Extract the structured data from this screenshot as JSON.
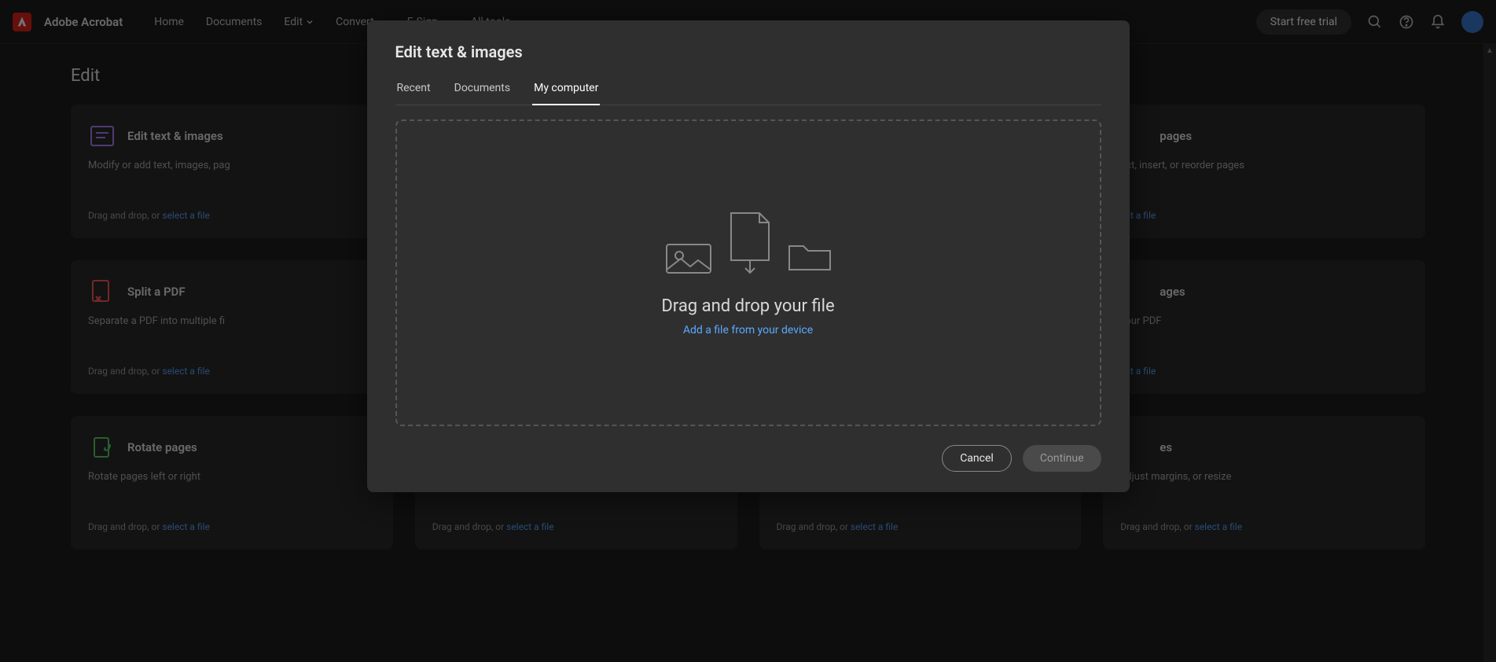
{
  "brand": "Adobe Acrobat",
  "nav": {
    "home": "Home",
    "documents": "Documents",
    "edit": "Edit",
    "convert": "Convert",
    "esign": "E-Sign",
    "alltools": "All tools"
  },
  "trial_btn": "Start free trial",
  "page_title": "Edit",
  "cards": [
    {
      "title": "Edit text & images",
      "desc": "Modify or add text, images, pag",
      "drag": "Drag and drop, or ",
      "link": "select a file"
    },
    {
      "title": "",
      "desc": "",
      "drag": "",
      "link": ""
    },
    {
      "title": "",
      "desc": "",
      "drag": "",
      "link": ""
    },
    {
      "title": "pages",
      "desc": "act, insert, or reorder pages",
      "drag": "",
      "link": "ect a file"
    },
    {
      "title": "Split a PDF",
      "desc": "Separate a PDF into multiple fi",
      "drag": "Drag and drop, or ",
      "link": "select a file"
    },
    {
      "title": "",
      "desc": "",
      "drag": "",
      "link": ""
    },
    {
      "title": "",
      "desc": "",
      "drag": "",
      "link": ""
    },
    {
      "title": "ages",
      "desc": "your PDF",
      "drag": "",
      "link": "ect a file"
    },
    {
      "title": "Rotate pages",
      "desc": "Rotate pages left or right",
      "drag": "Drag and drop, or ",
      "link": "select a file"
    },
    {
      "title": "",
      "desc": "",
      "drag": "Drag and drop, or ",
      "link": "select a file"
    },
    {
      "title": "",
      "desc": "",
      "drag": "Drag and drop, or ",
      "link": "select a file"
    },
    {
      "title": "es",
      "desc": "adjust margins, or resize",
      "drag": "Drag and drop, or ",
      "link": "select a file"
    }
  ],
  "modal": {
    "title": "Edit text & images",
    "tabs": {
      "recent": "Recent",
      "documents": "Documents",
      "mycomputer": "My computer"
    },
    "dz_title": "Drag and drop your file",
    "dz_link": "Add a file from your device",
    "cancel": "Cancel",
    "continue": "Continue"
  }
}
